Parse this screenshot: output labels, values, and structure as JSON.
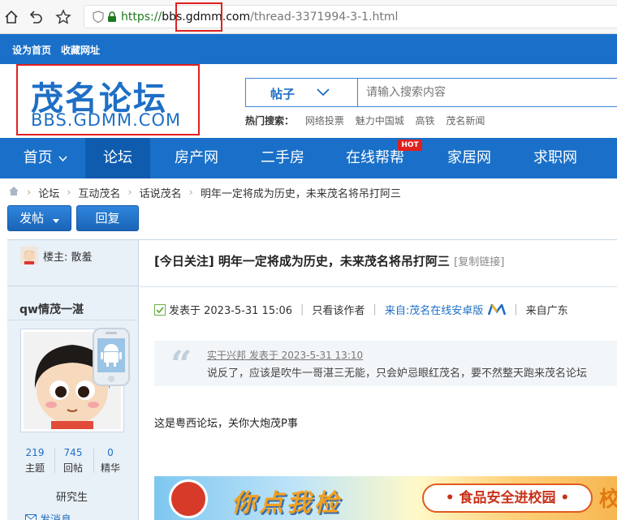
{
  "browser": {
    "url_https": "https://",
    "url_domain_pre": "bbs.",
    "url_domain_highlight": "gdmm",
    "url_domain_post": ".com",
    "url_path": "/thread-3371994-3-1.html"
  },
  "topbar": {
    "set_home": "设为首页",
    "bookmark": "收藏网址"
  },
  "logo": {
    "cn": "茂名论坛",
    "en": "BBS.GDMM.COM"
  },
  "search": {
    "type_label": "帖子",
    "placeholder": "请输入搜索内容",
    "hot_title": "热门搜索：",
    "hot_items": [
      "网络投票",
      "魅力中国城",
      "高铁",
      "茂名新闻"
    ]
  },
  "nav": {
    "items": [
      {
        "label": "首页"
      },
      {
        "label": "论坛"
      },
      {
        "label": "房产网"
      },
      {
        "label": "二手房"
      },
      {
        "label": "在线帮帮"
      },
      {
        "label": "家居网"
      },
      {
        "label": "求职网"
      }
    ],
    "hot_badge": "HOT"
  },
  "breadcrumb": [
    "论坛",
    "互动茂名",
    "话说茂名",
    "明年一定将成为历史，未来茂名将吊打阿三"
  ],
  "actions": {
    "post": "发帖",
    "reply": "回复"
  },
  "sidebar": {
    "op_label": "楼主: 散羞",
    "username": "qw情茂一湛",
    "stats": [
      {
        "num": "219",
        "label": "主题"
      },
      {
        "num": "745",
        "label": "回帖"
      },
      {
        "num": "0",
        "label": "精华"
      }
    ],
    "rank": "研究生",
    "send_message": "发消息"
  },
  "post": {
    "title": "[今日关注] 明年一定将成为历史，未来茂名将吊打阿三",
    "copy_link": "[复制链接]",
    "posted_at": "发表于 2023-5-31 15:06",
    "author_only": "只看该作者",
    "source": "来自:茂名在线安卓版",
    "location": "来自广东",
    "quote_head": "实干兴邦 发表于 2023-5-31 13:10",
    "quote_body": "说反了，应该是吹牛一哥湛三无能，只会妒忌眼红茂名，要不然整天跑来茂名论坛",
    "body": "这是粤西论坛，关你大炮茂P事"
  },
  "banner": {
    "slogan": "你点我检",
    "pill": "• 食品安全进校园 •",
    "tail": "校"
  },
  "colors": {
    "brand_blue": "#1a70c8",
    "active_nav": "#0f5caf",
    "link_blue": "#1e6fc5",
    "highlight_red": "#e02020"
  }
}
